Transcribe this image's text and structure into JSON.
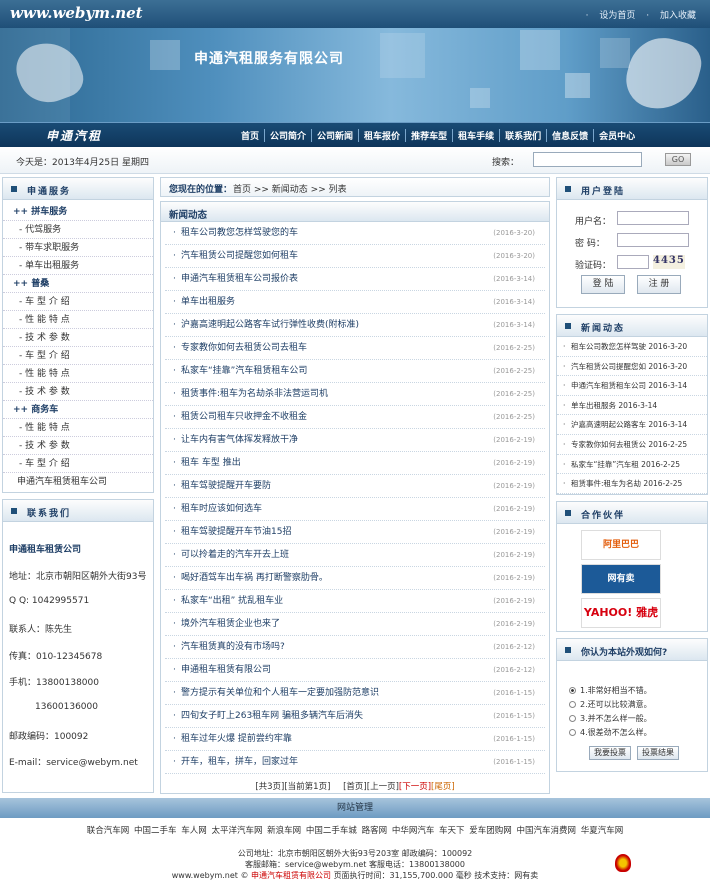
{
  "header": {
    "site_url": "www.webym.net",
    "set_home": "设为首页",
    "add_favorite": "加入收藏",
    "banner_title": "申通汽租服务有限公司",
    "brand": "申通汽租"
  },
  "nav": [
    "首页",
    "公司简介",
    "公司新闻",
    "租车报价",
    "推荐车型",
    "租车手续",
    "联系我们",
    "信息反馈",
    "会员中心"
  ],
  "datebar": {
    "date": "今天是：2013年4月25日  星期四",
    "search_label": "搜索：",
    "go": "GO"
  },
  "left_menu": {
    "title": "申通服务",
    "items": [
      {
        "label": "++ 拼车服务",
        "type": "cat"
      },
      {
        "label": "- 代驾服务",
        "type": "sub"
      },
      {
        "label": "- 带车求职服务",
        "type": "sub"
      },
      {
        "label": "- 单车出租服务",
        "type": "sub"
      },
      {
        "label": "++ 普桑",
        "type": "cat"
      },
      {
        "label": "- 车 型 介 绍",
        "type": "sub"
      },
      {
        "label": "- 性 能 特 点",
        "type": "sub"
      },
      {
        "label": "- 技 术 参 数",
        "type": "sub"
      },
      {
        "label": "- 车 型 介 绍",
        "type": "sub"
      },
      {
        "label": "- 性 能 特 点",
        "type": "sub"
      },
      {
        "label": "- 技 术 参 数",
        "type": "sub"
      },
      {
        "label": "++ 商务车",
        "type": "cat"
      },
      {
        "label": "- 性 能 特 点",
        "type": "sub"
      },
      {
        "label": "- 技 术 参 数",
        "type": "sub"
      },
      {
        "label": "- 车 型 介 绍",
        "type": "sub"
      },
      {
        "label": "申通汽车租赁租车公司",
        "type": "plain"
      }
    ]
  },
  "contact": {
    "title": "联系我们",
    "company": "申通租车租赁公司",
    "address": "地址：北京市朝阳区朝外大街93号",
    "qq": "Q Q: 1042995571",
    "person": "联系人：陈先生",
    "fax": "传真：010-12345678",
    "mobile1": "手机：13800138000",
    "mobile2": "13600136000",
    "zip": "邮政编码：100092",
    "email": "E-mail：service@webym.net"
  },
  "breadcrumb": {
    "prefix": "您现在的位置：",
    "path": "首页 >> 新闻动态 >> 列表"
  },
  "news": {
    "title": "新闻动态",
    "items": [
      {
        "title": "租车公司教您怎样驾驶您的车",
        "date": "(2016-3-20)"
      },
      {
        "title": "汽车租赁公司提醒您如何租车",
        "date": "(2016-3-20)"
      },
      {
        "title": "申通汽车租赁租车公司报价表",
        "date": "(2016-3-14)"
      },
      {
        "title": "单车出租服务",
        "date": "(2016-3-14)"
      },
      {
        "title": "沪嘉高速明起公路客车试行弹性收费(附标准)",
        "date": "(2016-3-14)"
      },
      {
        "title": "专家教你如何去租赁公司去租车",
        "date": "(2016-2-25)"
      },
      {
        "title": "私家车“挂靠”汽车租赁租车公司",
        "date": "(2016-2-25)"
      },
      {
        "title": "租赁事件:租车为名劫杀非法营运司机",
        "date": "(2016-2-25)"
      },
      {
        "title": "租赁公司租车只收押金不收租金",
        "date": "(2016-2-25)"
      },
      {
        "title": "让车内有害气体挥发释放干净",
        "date": "(2016-2-19)"
      },
      {
        "title": "租车 车型 推出",
        "date": "(2016-2-19)"
      },
      {
        "title": "租车驾驶提醒开车要防",
        "date": "(2016-2-19)"
      },
      {
        "title": "租车时应该如何选车",
        "date": "(2016-2-19)"
      },
      {
        "title": "租车驾驶提醒开车节油15招",
        "date": "(2016-2-19)"
      },
      {
        "title": "可以拎着走的汽车开去上班",
        "date": "(2016-2-19)"
      },
      {
        "title": "喝好酒驾车出车祸 再打断警察肋骨。",
        "date": "(2016-2-19)"
      },
      {
        "title": "私家车“出租” 扰乱租车业",
        "date": "(2016-2-19)"
      },
      {
        "title": "境外汽车租赁企业也来了",
        "date": "(2016-2-19)"
      },
      {
        "title": "汽车租赁真的没有市场吗?",
        "date": "(2016-2-12)"
      },
      {
        "title": "申通租车租赁有限公司",
        "date": "(2016-2-12)"
      },
      {
        "title": "警方提示有关单位和个人租车一定要加强防范意识",
        "date": "(2016-1-15)"
      },
      {
        "title": "四旬女子盯上263租车网 骗租多辆汽车后消失",
        "date": "(2016-1-15)"
      },
      {
        "title": "租车过年火爆 提前尝约牢靠",
        "date": "(2016-1-15)"
      },
      {
        "title": "开车，租车，拼车，回家过年",
        "date": "(2016-1-15)"
      }
    ],
    "pagination": {
      "total": "[共3页][当前第1页]",
      "first": "[首页]",
      "prev": "[上一页]",
      "next": "[下一页]",
      "last": "[尾页]"
    }
  },
  "login": {
    "title": "用户登陆",
    "username_label": "用户名：",
    "password_label": "密  码：",
    "captcha_label": "验证码：",
    "captcha_code": "4435",
    "login_button": "登 陆",
    "register_button": "注 册"
  },
  "side_news": {
    "title": "新闻动态",
    "items": [
      {
        "title": "租车公司教您怎样驾驶",
        "date": "2016-3-20"
      },
      {
        "title": "汽车租赁公司提醒您如",
        "date": "2016-3-20"
      },
      {
        "title": "申通汽车租赁租车公司",
        "date": "2016-3-14"
      },
      {
        "title": "单车出租服务",
        "date": "2016-3-14"
      },
      {
        "title": "沪嘉高速明起公路客车",
        "date": "2016-3-14"
      },
      {
        "title": "专家教你如何去租赁公",
        "date": "2016-2-25"
      },
      {
        "title": "私家车“挂靠”汽车租",
        "date": "2016-2-25"
      },
      {
        "title": "租赁事件:租车为名劫",
        "date": "2016-2-25"
      }
    ]
  },
  "partners": {
    "title": "合作伙伴",
    "logos": [
      "阿里巴巴 Alibaba.com.cn",
      "网有卖 www.webym.net",
      "YAHOO! 雅虎"
    ]
  },
  "poll": {
    "title": "你认为本站外观如何?",
    "options": [
      "1.非常好相当不错。",
      "2.还可以比较满意。",
      "3.并不怎么样一般。",
      "4.很差劲不怎么样。"
    ],
    "vote_button": "我要投票",
    "result_button": "投票结果"
  },
  "footer": {
    "heading": "网站管理",
    "links": [
      "联合汽车网",
      "中国二手车",
      "车人网",
      "太平洋汽车网",
      "新浪车网",
      "中国二手车城",
      "路客网",
      "中华网汽车",
      "车天下",
      "爱车团购网",
      "中国汽车消费网",
      "华夏汽车网"
    ],
    "line1": "公司地址：北京市朝阳区朝外大街93号203室  邮政编码：100092",
    "line2": "客服邮箱：service@webym.net  客服电话：13800138000",
    "line3_prefix": "www.webym.net ©",
    "line3_company": "申通汽车租赁有限公司",
    "line3_suffix": "页面执行时间：31,155,700.000 毫秒  技术支持：网有卖"
  }
}
